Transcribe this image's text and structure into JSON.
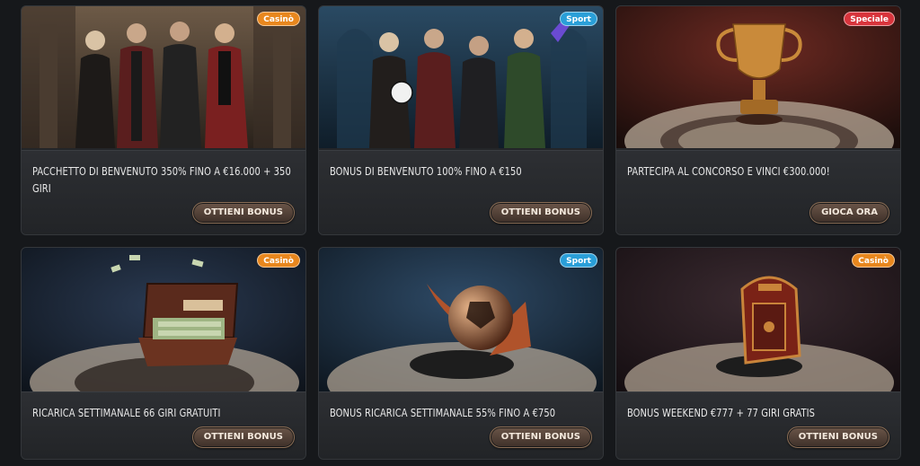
{
  "colors": {
    "casino_badge": "#e8871e",
    "sport_badge": "#2a9fd8",
    "speciale_badge": "#d8343c",
    "button_bg": "#5a463b",
    "page_bg": "#16181b"
  },
  "promotions": [
    {
      "badge": "Casinò",
      "badge_type": "casino",
      "image": "group-of-four-hosts-in-casino-lobby",
      "title": "PACCHETTO DI BENVENUTO 350% FINO A €16.000 + 350 GIRI",
      "button": "OTTIENI BONUS"
    },
    {
      "badge": "Sport",
      "badge_type": "sport",
      "image": "four-hosts-cheering-with-football",
      "title": "BONUS DI BENVENUTO 100% FINO A €150",
      "button": "OTTIENI BONUS"
    },
    {
      "badge": "Speciale",
      "badge_type": "speciale",
      "image": "golden-trophy-cup",
      "title": "PARTECIPA AL CONCORSO E VINCI €300.000!",
      "button": "GIOCA ORA"
    },
    {
      "badge": "Casinò",
      "badge_type": "casino",
      "image": "suitcase-full-of-cash",
      "title": "RICARICA SETTIMANALE 66 GIRI GRATUITI",
      "button": "OTTIENI BONUS"
    },
    {
      "badge": "Sport",
      "badge_type": "sport",
      "image": "football-with-arrow",
      "title": "BONUS RICARICA SETTIMANALE 55% FINO A €750",
      "button": "OTTIENI BONUS"
    },
    {
      "badge": "Casinò",
      "badge_type": "casino",
      "image": "premium-treasure-chest",
      "title": "BONUS WEEKEND €777 + 77 GIRI GRATIS",
      "button": "OTTIENI BONUS"
    }
  ]
}
